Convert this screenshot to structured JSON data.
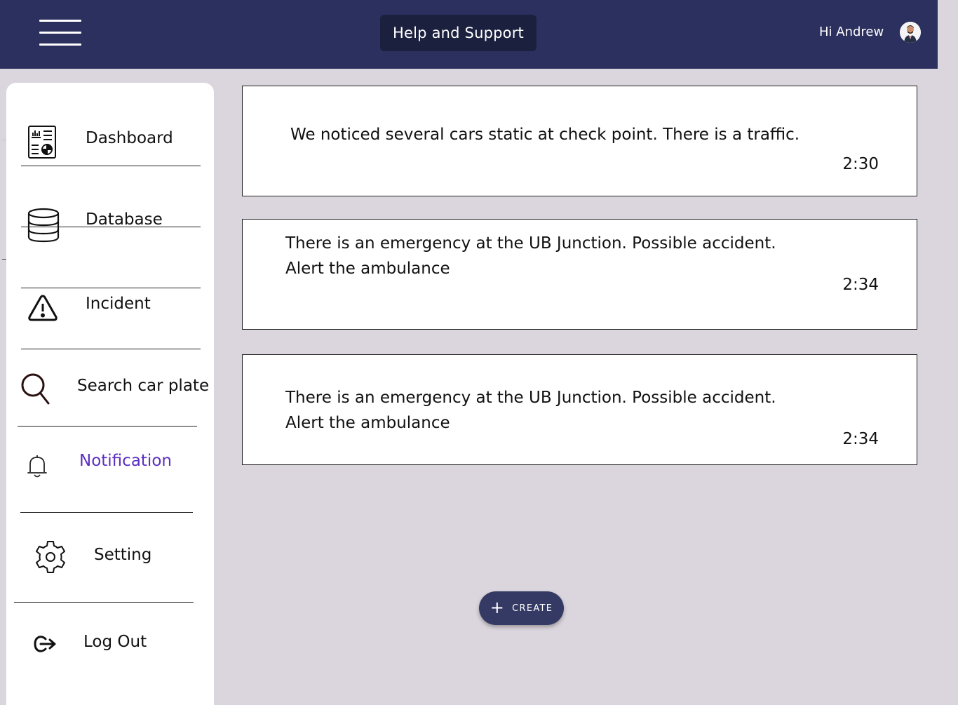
{
  "header": {
    "help_label": "Help and Support",
    "greeting": "Hi Andrew",
    "avatar_icon": "user-avatar-icon"
  },
  "sidebar": {
    "items": [
      {
        "label": "Dashboard",
        "icon": "dashboard-report-icon"
      },
      {
        "label": "Database",
        "icon": "database-icon"
      },
      {
        "label": "Incident",
        "icon": "warning-triangle-icon"
      },
      {
        "label": "Search car plate",
        "icon": "search-icon"
      },
      {
        "label": "Notification",
        "icon": "bell-icon",
        "active": true
      },
      {
        "label": "Setting",
        "icon": "gear-icon"
      },
      {
        "label": "Log Out",
        "icon": "logout-icon"
      }
    ]
  },
  "notifications": [
    {
      "message": "We noticed several cars static at check point. There is a traffic.",
      "time": "2:30"
    },
    {
      "message_line1": "There is an emergency at the UB Junction. Possible accident.",
      "message_line2": "Alert the ambulance",
      "time": "2:34"
    },
    {
      "message_line1": "There is an emergency at the UB Junction. Possible accident.",
      "message_line2": "Alert the ambulance",
      "time": "2:34"
    }
  ],
  "fab": {
    "label": "CREATE",
    "icon": "plus-icon"
  },
  "colors": {
    "header_bg": "#2c305e",
    "help_btn_bg": "#1c203f",
    "page_bg": "#dbd6dd",
    "active_nav": "#5b2fc0",
    "fab_bg": "#343a63"
  }
}
